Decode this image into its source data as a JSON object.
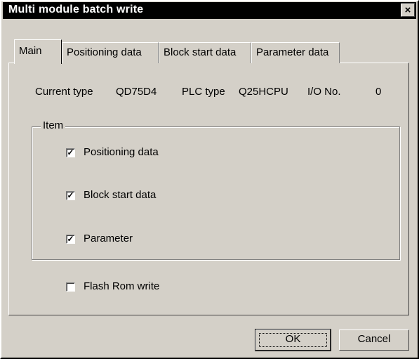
{
  "window": {
    "title": "Multi module batch write",
    "close_label": "×"
  },
  "tabs": [
    {
      "label": "Main",
      "active": true
    },
    {
      "label": "Positioning data",
      "active": false
    },
    {
      "label": "Block start data",
      "active": false
    },
    {
      "label": "Parameter data",
      "active": false
    }
  ],
  "info": {
    "current_type_label": "Current type",
    "current_type_value": "QD75D4",
    "plc_type_label": "PLC type",
    "plc_type_value": "Q25HCPU",
    "io_no_label": "I/O No.",
    "io_no_value": "0"
  },
  "item_group": {
    "label": "Item",
    "checkboxes": [
      {
        "label": "Positioning data",
        "checked": true
      },
      {
        "label": "Block start data",
        "checked": true
      },
      {
        "label": "Parameter",
        "checked": true
      }
    ]
  },
  "flash_rom": {
    "label": "Flash Rom write",
    "checked": false
  },
  "buttons": {
    "ok": "OK",
    "cancel": "Cancel"
  },
  "check_mark": "✓"
}
